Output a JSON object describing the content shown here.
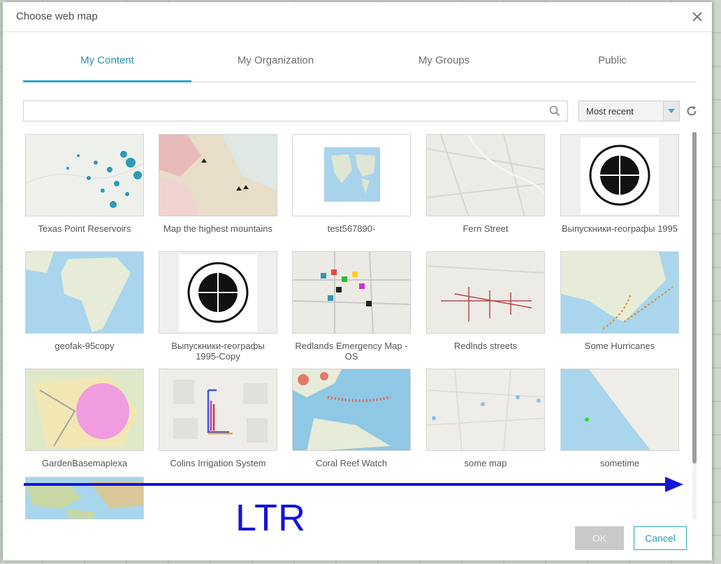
{
  "dialog": {
    "title": "Choose web map",
    "close_icon": "close-icon"
  },
  "tabs": [
    {
      "label": "My Content",
      "active": true
    },
    {
      "label": "My Organization",
      "active": false
    },
    {
      "label": "My Groups",
      "active": false
    },
    {
      "label": "Public",
      "active": false
    }
  ],
  "search": {
    "value": "",
    "placeholder": "",
    "icon": "search-icon"
  },
  "sort": {
    "selected": "Most recent",
    "icon": "chevron-down-icon"
  },
  "refresh_icon": "refresh-icon",
  "items": [
    {
      "title": "Texas Point Reservoirs"
    },
    {
      "title": "Map the highest mountains"
    },
    {
      "title": "test567890-"
    },
    {
      "title": "Fern Street"
    },
    {
      "title": "Выпускники-географы 1995"
    },
    {
      "title": "geofak-95copy"
    },
    {
      "title": "Выпускники-географы 1995-Copy"
    },
    {
      "title": "Redlands Emergency Map - OS"
    },
    {
      "title": "Redlnds streets"
    },
    {
      "title": "Some Hurricanes"
    },
    {
      "title": "GardenBasemaplexa"
    },
    {
      "title": "Colins Irrigation System"
    },
    {
      "title": "Coral Reef Watch"
    },
    {
      "title": "some map"
    },
    {
      "title": "sometime"
    },
    {
      "title": ""
    }
  ],
  "annotation": {
    "text": "LTR",
    "color": "#1414d8"
  },
  "buttons": {
    "ok": "OK",
    "cancel": "Cancel"
  },
  "colors": {
    "accent": "#2aa8c4",
    "ok_disabled": "#c9c9c9"
  }
}
